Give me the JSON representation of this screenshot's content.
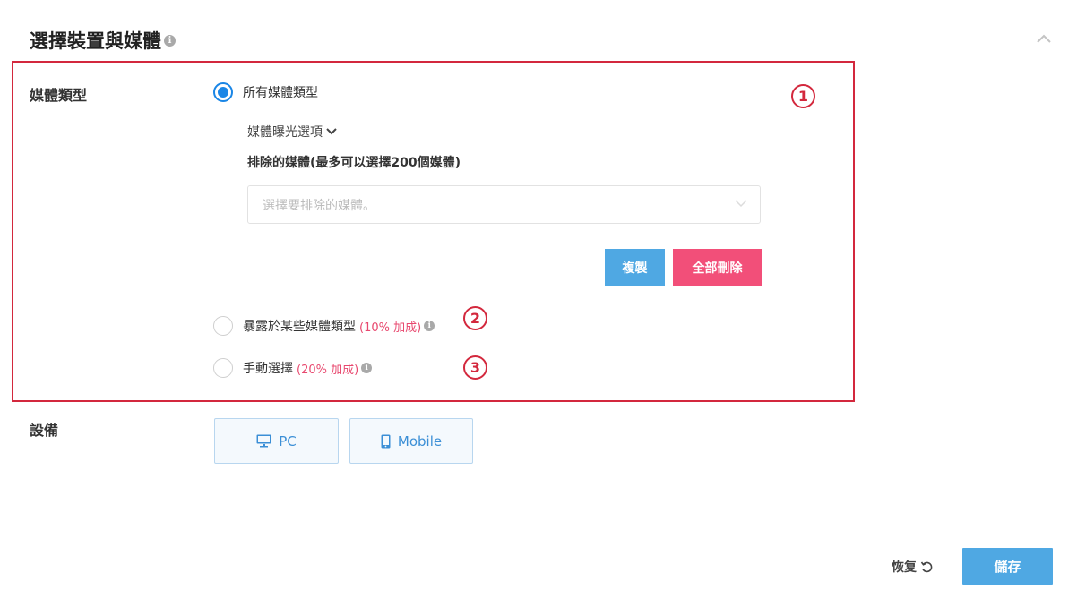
{
  "section": {
    "title": "選擇裝置與媒體",
    "info_icon": "info-icon",
    "collapse_icon": "chevron-up-icon"
  },
  "media_type": {
    "label": "媒體類型",
    "options": [
      {
        "label": "所有媒體類型",
        "bonus": "",
        "selected": true
      },
      {
        "label": "暴露於某些媒體類型",
        "bonus": "(10% 加成)",
        "selected": false
      },
      {
        "label": "手動選擇",
        "bonus": "(20% 加成)",
        "selected": false
      }
    ],
    "exposure_toggle": "媒體曝光選項",
    "exclude_label": "排除的媒體(最多可以選擇200個媒體)",
    "exclude_placeholder": "選擇要排除的媒體。",
    "copy_button": "複製",
    "delete_all_button": "全部刪除"
  },
  "annotations": {
    "markers": [
      "1",
      "2",
      "3"
    ],
    "highlight_color": "#d3283d"
  },
  "device": {
    "label": "設備",
    "options": [
      {
        "label": "PC",
        "icon": "desktop-icon"
      },
      {
        "label": "Mobile",
        "icon": "mobile-icon"
      }
    ]
  },
  "footer": {
    "restore_label": "恢复",
    "restore_icon": "undo-icon",
    "save_label": "儲存"
  },
  "colors": {
    "accent": "#1a86e6",
    "button_blue": "#4fa8e3",
    "button_pink": "#f24f79",
    "bonus_text": "#e8496f"
  }
}
